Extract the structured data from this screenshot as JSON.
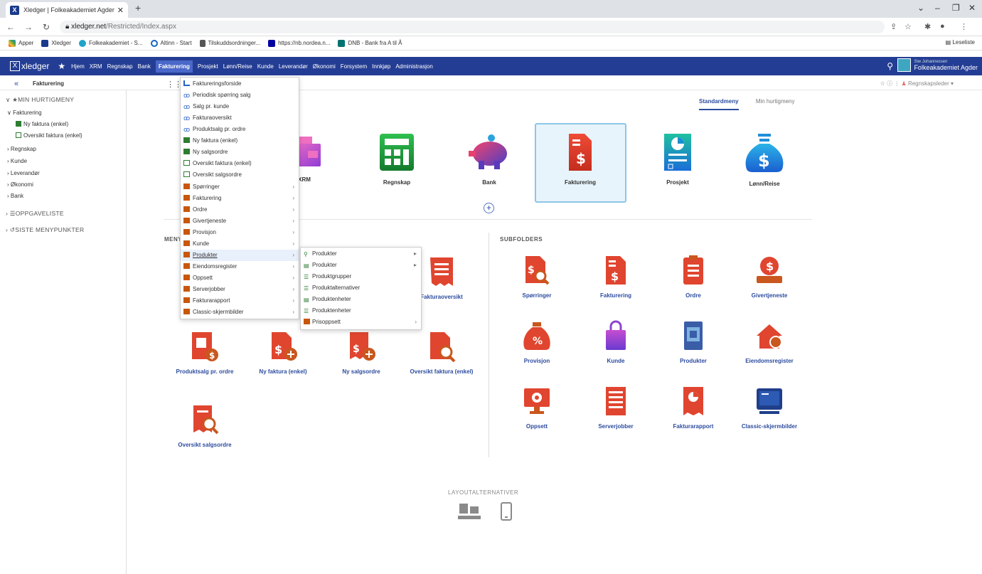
{
  "browser": {
    "tab_title": "Xledger | Folkeakademiet Agder",
    "url_host": "xledger.net",
    "url_path": "/Restricted/Index.aspx",
    "bookmarks": [
      "Apper",
      "Xledger",
      "Folkeakademiet - S...",
      "Altinn - Start",
      "Tilskuddsordninger...",
      "https://nb.nordea.n...",
      "DNB - Bank fra A til Å"
    ],
    "reading_list": "Leseliste"
  },
  "appnav": {
    "logo": "xledger",
    "items": [
      "Hjem",
      "XRM",
      "Regnskap",
      "Bank",
      "Fakturering",
      "Prosjekt",
      "Lønn/Reise",
      "Kunde",
      "Leverandør",
      "Økonomi",
      "Forsystem",
      "Innkjøp",
      "Administrasjon"
    ],
    "user_name": "Siw Johannessen",
    "company": "Folkeakademiet Agder"
  },
  "subbar": {
    "title": "Fakturering",
    "role": "Regnskapsleder"
  },
  "sidebar": {
    "hurtig": "MIN HURTIGMENY",
    "group": "Fakturering",
    "links": [
      "Ny faktura (enkel)",
      "Oversikt faktura (enkel)"
    ],
    "items": [
      "Regnskap",
      "Kunde",
      "Leverandør",
      "Økonomi",
      "Bank"
    ],
    "oppgave": "OPPGAVELISTE",
    "siste": "SISTE MENYPUNKTER"
  },
  "switch": {
    "standard": "Standardmeny",
    "hurtig": "Min hurtigmeny"
  },
  "modules": [
    "XRM",
    "Regnskap",
    "Bank",
    "Fakturering",
    "Prosjekt",
    "Lønn/Reise"
  ],
  "menu_heading": "MENY",
  "subfolders_heading": "SUBFOLDERS",
  "menu_tiles": [
    "Fakturaoversikt",
    "Produktsalg pr. ordre",
    "Ny faktura (enkel)",
    "Ny salgsordre",
    "Oversikt faktura (enkel)",
    "Oversikt salgsordre"
  ],
  "subfolders": [
    "Spørringer",
    "Fakturering",
    "Ordre",
    "Givertjeneste",
    "Provisjon",
    "Kunde",
    "Produkter",
    "Eiendomsregister",
    "Oppsett",
    "Serverjobber",
    "Fakturarapport",
    "Classic-skjermbilder"
  ],
  "layout_heading": "LAYOUTALTERNATIVER",
  "dropdown": [
    "Faktureringsforside",
    "Periodisk spørring salg",
    "Salg pr. kunde",
    "Fakturaoversikt",
    "Produktsalg pr. ordre",
    "Ny faktura (enkel)",
    "Ny salgsordre",
    "Oversikt faktura (enkel)",
    "Oversikt salgsordre",
    "Spørringer",
    "Fakturering",
    "Ordre",
    "Givertjeneste",
    "Provisjon",
    "Kunde",
    "Produkter",
    "Eiendomsregister",
    "Oppsett",
    "Serverjobber",
    "Fakturarapport",
    "Classic-skjermbilder"
  ],
  "submenu": [
    "Produkter",
    "Produkter",
    "Produktgrupper",
    "Produktalternativer",
    "Produktenheter",
    "Produktenheter",
    "Prisoppsett"
  ],
  "colors": {
    "nav": "#243d94",
    "accent": "#2d4c9e",
    "folder": "#c8570c",
    "tile_red": "#d93a2b"
  }
}
